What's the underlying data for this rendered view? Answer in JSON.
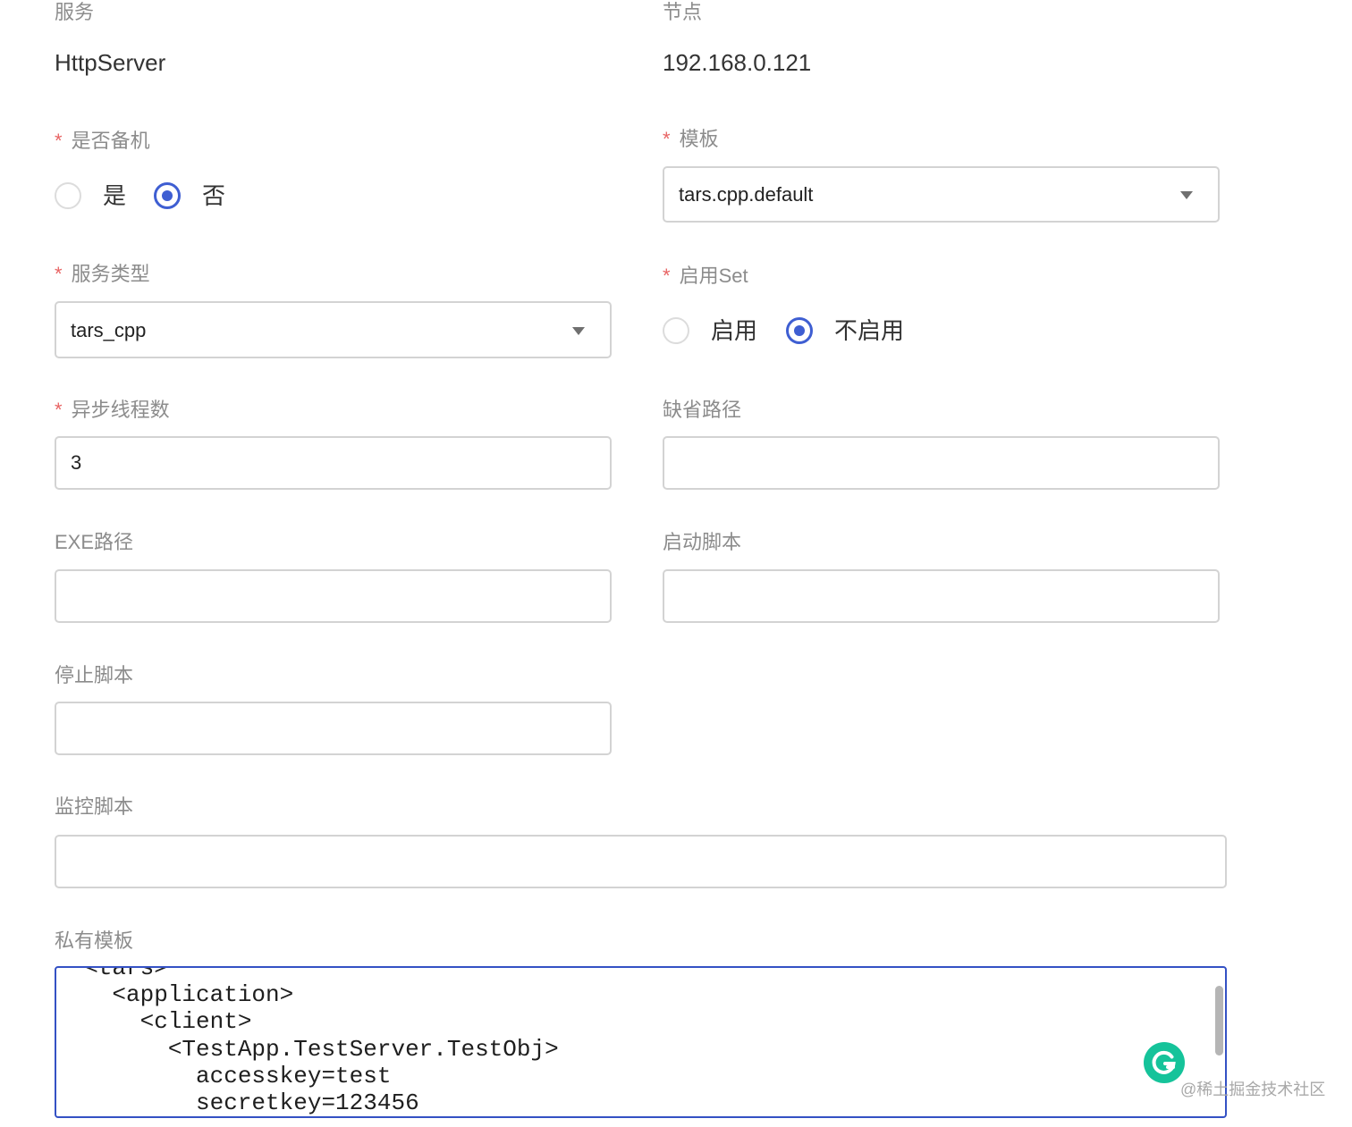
{
  "form": {
    "service": {
      "label": "服务",
      "value": "HttpServer"
    },
    "node": {
      "label": "节点",
      "value": "192.168.0.121"
    },
    "standby": {
      "label": "是否备机",
      "required_mark": "*",
      "options": [
        {
          "label": "是",
          "checked": false
        },
        {
          "label": "否",
          "checked": true
        }
      ]
    },
    "template": {
      "label": "模板",
      "required_mark": "*",
      "value": "tars.cpp.default"
    },
    "service_type": {
      "label": "服务类型",
      "required_mark": "*",
      "value": "tars_cpp"
    },
    "enable_set": {
      "label": "启用Set",
      "required_mark": "*",
      "options": [
        {
          "label": "启用",
          "checked": false
        },
        {
          "label": "不启用",
          "checked": true
        }
      ]
    },
    "async_threads": {
      "label": "异步线程数",
      "required_mark": "*",
      "value": "3"
    },
    "default_path": {
      "label": "缺省路径",
      "value": ""
    },
    "exe_path": {
      "label": "EXE路径",
      "value": ""
    },
    "start_script": {
      "label": "启动脚本",
      "value": ""
    },
    "stop_script": {
      "label": "停止脚本",
      "value": ""
    },
    "monitor_script": {
      "label": "监控脚本",
      "value": ""
    },
    "private_template": {
      "label": "私有模板",
      "lines": [
        "  <tars>",
        "    <application>",
        "      <client>",
        "        <TestApp.TestServer.TestObj>",
        "          accesskey=test",
        "          secretkey=123456"
      ]
    }
  },
  "overlay": {
    "grammarly_icon": "grammarly-g-icon",
    "watermark": "@稀土掘金技术社区"
  },
  "colors": {
    "accent": "#3e5ed2",
    "required": "#e86464",
    "label": "#8c8c8c",
    "border": "#d3d3d3",
    "grammarly": "#15c39a"
  }
}
